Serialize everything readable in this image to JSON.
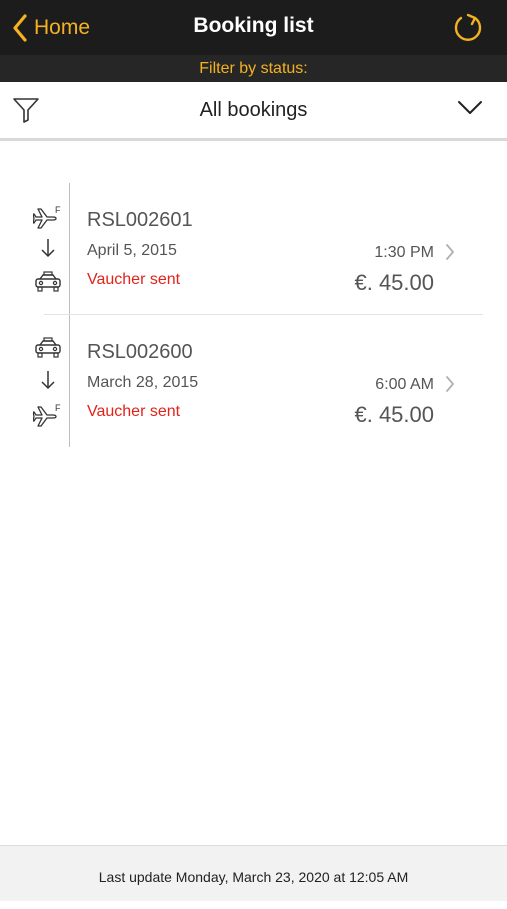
{
  "nav": {
    "back_label": "Home",
    "title": "Booking list",
    "accent_color": "#f4b223"
  },
  "filter": {
    "label": "Filter by status:",
    "selected": "All bookings"
  },
  "bookings": [
    {
      "code": "RSL002601",
      "date": "April 5, 2015",
      "time": "1:30 PM",
      "status": "Vaucher sent",
      "price": "€. 45.00",
      "from_icon": "plane-icon",
      "to_icon": "taxi-icon"
    },
    {
      "code": "RSL002600",
      "date": "March 28, 2015",
      "time": "6:00 AM",
      "status": "Vaucher sent",
      "price": "€. 45.00",
      "from_icon": "taxi-icon",
      "to_icon": "plane-icon"
    }
  ],
  "footer": {
    "last_update": "Last update Monday, March 23, 2020 at 12:05 AM"
  }
}
